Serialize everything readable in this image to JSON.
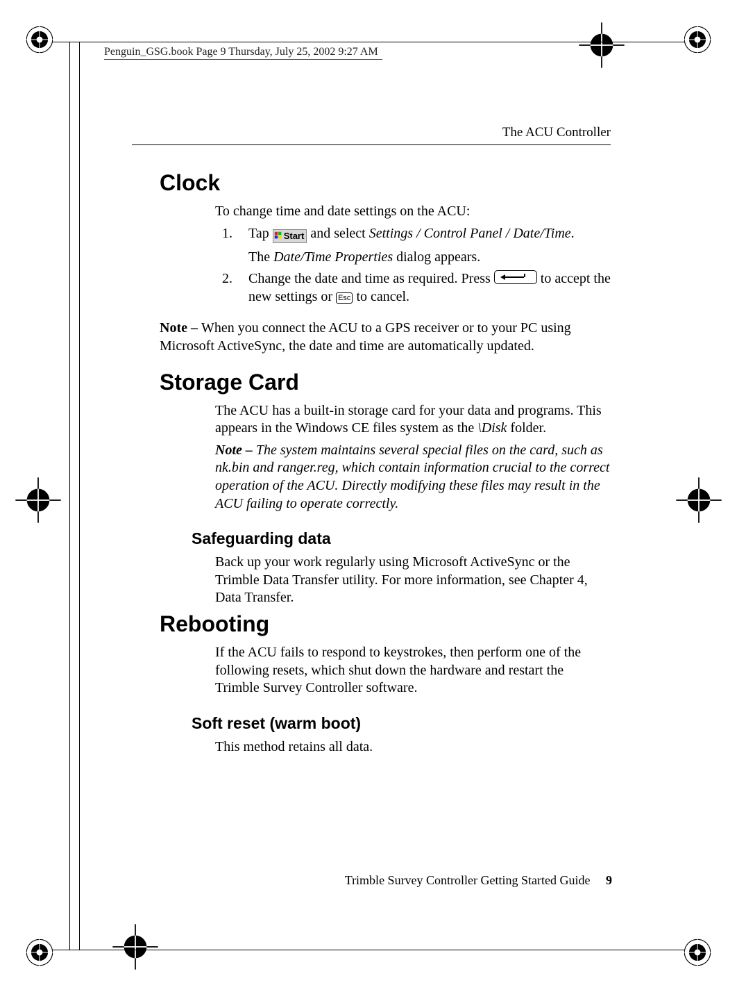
{
  "stamp": "Penguin_GSG.book  Page 9  Thursday, July 25, 2002  9:27 AM",
  "running_head": "The ACU Controller",
  "sections": {
    "clock": {
      "title": "Clock",
      "intro": "To change time and date settings on the ACU:",
      "step1_a": "Tap ",
      "start_label": "Start",
      "step1_b": " and select ",
      "step1_path": "Settings / Control Panel / Date/Time",
      "step1_c": ".",
      "step1_result_a": "The ",
      "step1_result_i": "Date/Time Properties",
      "step1_result_b": " dialog appears.",
      "step2_a": "Change the date and time as required. Press ",
      "step2_b": " to accept the new settings or ",
      "esc_label": "Esc",
      "step2_c": " to cancel.",
      "note_label": "Note – ",
      "note_body": "When you connect the ACU to a GPS receiver or to your PC using Microsoft ActiveSync, the date and time are automatically updated."
    },
    "storage": {
      "title": "Storage Card",
      "p1_a": "The ACU has a built-in storage card for your data and programs. This appears in the Windows CE files system as the ",
      "p1_i": "\\Disk",
      "p1_b": " folder.",
      "note_label": "Note – ",
      "note_body": "The system maintains several special files on the card, such as nk.bin and ranger.reg, which contain information crucial to the correct operation of the ACU. Directly modifying these files may result in the ACU failing to operate correctly.",
      "sub": "Safeguarding data",
      "sub_body": "Back up your work regularly using Microsoft ActiveSync or the Trimble Data Transfer utility. For more information, see Chapter 4, Data Transfer."
    },
    "reboot": {
      "title": "Rebooting",
      "p1": "If the ACU fails to respond to keystrokes, then perform one of the following resets, which shut down the hardware and restart the Trimble Survey Controller software.",
      "sub": "Soft reset (warm boot)",
      "sub_body": "This method retains all data."
    }
  },
  "footer": {
    "text": "Trimble Survey Controller Getting Started Guide",
    "page": "9"
  }
}
